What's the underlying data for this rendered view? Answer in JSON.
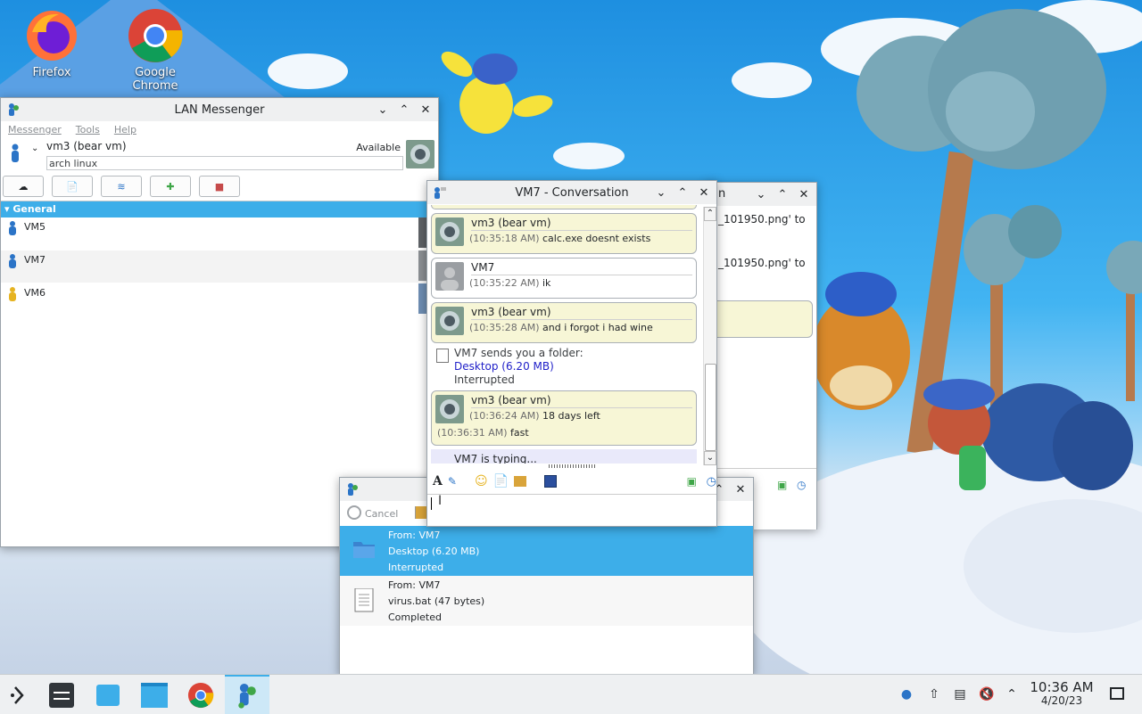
{
  "desktop": {
    "icons": [
      {
        "label": "Firefox",
        "icon": "firefox-icon"
      },
      {
        "label": "Google Chrome",
        "icon": "chrome-icon"
      }
    ]
  },
  "messenger": {
    "title": "LAN Messenger",
    "menu": [
      "Messenger",
      "Tools",
      "Help"
    ],
    "user_name": "vm3 (bear vm)",
    "status": "Available",
    "note": "arch linux",
    "group": "General",
    "contacts": [
      {
        "name": "VM5"
      },
      {
        "name": "VM7"
      },
      {
        "name": "VM6"
      }
    ]
  },
  "conversation": {
    "title": "VM7 - Conversation",
    "messages": [
      {
        "sender": "vm3 (bear vm)",
        "time": "(10:35:18 AM)",
        "text": "calc.exe doesnt exists"
      },
      {
        "sender": "VM7",
        "time": "(10:35:22 AM)",
        "text": "ik"
      },
      {
        "sender": "vm3 (bear vm)",
        "time": "(10:35:28 AM)",
        "text": "and i forgot i had wine"
      }
    ],
    "folder_notice": {
      "line1": "VM7 sends you a folder:",
      "link": "Desktop (6.20 MB)",
      "status": "Interrupted"
    },
    "last_block": {
      "sender": "vm3 (bear vm)",
      "time1": "(10:36:24 AM)",
      "text1": "18 days left",
      "time2": "(10:36:31 AM)",
      "text2": "fast"
    },
    "typing": "VM7 is typing...",
    "input_value": ""
  },
  "background_window": {
    "title_fragment": "n",
    "line1": "_101950.png' to",
    "line2": "_101950.png' to"
  },
  "file_transfer": {
    "cancel_label": "Cancel",
    "items": [
      {
        "from": "From: VM7",
        "name": "Desktop (6.20 MB)",
        "status": "Interrupted",
        "icon": "folder-icon",
        "selected": true
      },
      {
        "from": "From: VM7",
        "name": "virus.bat (47 bytes)",
        "status": "Completed",
        "icon": "document-icon",
        "selected": false
      }
    ]
  },
  "taskbar": {
    "time": "10:36 AM",
    "date": "4/20/23"
  },
  "colors": {
    "accent": "#3daee9",
    "bubble": "#f7f6d6",
    "typing_bg": "#e9e9fa",
    "link": "#1e1ec8"
  }
}
